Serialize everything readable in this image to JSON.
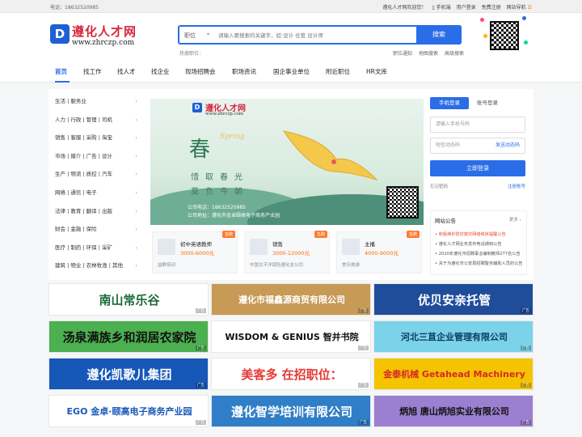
{
  "topbar": {
    "phone": "电话：18632520985",
    "welcome": "遵化人才网欢迎您！",
    "mobile": "手机端",
    "login": "用户登录",
    "register": "免费注册",
    "site_nav": "网站导航"
  },
  "logo": {
    "mark": "D",
    "cn": "遵化人才网",
    "en": "www.zhrczp.com"
  },
  "search": {
    "type_label": "职位",
    "placeholder": "请输入要搜索的关键字，如 设计 仓管 设计师",
    "button": "搜索",
    "hot_label": "热搜职位：",
    "links": [
      "职位通知",
      "地图搜索",
      "高级搜索"
    ]
  },
  "nav": {
    "items": [
      "首页",
      "找工作",
      "找人才",
      "找企业",
      "现场招聘会",
      "职场资讯",
      "国企事业单位",
      "附近职位",
      "HR文库"
    ]
  },
  "categories": [
    "生活 | 服务业",
    "人力 | 行政 | 管理 | 司机",
    "销售 | 客服 | 采购 | 淘宝",
    "市场 | 媒介 | 广告 | 设计",
    "生产 | 物流 | 质控 | 汽车",
    "网络 | 通信 | 电子",
    "法律 | 教育 | 翻译 | 出版",
    "财会 | 金融 | 保险",
    "医疗 | 制药 | 环保 | 采矿",
    "建筑 | 物业 | 农林牧渔 | 其他"
  ],
  "category_arrow": "›",
  "banner": {
    "logo_mark": "D",
    "logo_cn": "遵化人才网",
    "logo_en": "www.zhrczp.com",
    "spring": "春",
    "spring_en": "Spring",
    "poem_line1": "惜取春光",
    "poem_line2": "莫负今朝",
    "phone": "公司电话：18632520985",
    "address": "公司地址：遵化市金卓颐高电子商务产业园"
  },
  "jobs": [
    {
      "tag": "急聘",
      "logo": "",
      "title": "初中英语教师",
      "salary": "3000-6000元",
      "company": "益群培训"
    },
    {
      "tag": "急聘",
      "logo": "",
      "title": "销售",
      "salary": "3000-12000元",
      "company": "中国太平洋保险遵化支公司"
    },
    {
      "tag": "急聘",
      "logo": "",
      "title": "主播",
      "salary": "4000-9000元",
      "company": "常乐旅游"
    }
  ],
  "login": {
    "tab_mobile": "手机登录",
    "tab_account": "账号登录",
    "phone_placeholder": "请输入手机号码",
    "code_placeholder": "短信动态码",
    "send_code": "发送动态码",
    "submit": "立即登录",
    "forgot": "忘记密码",
    "register": "注册账号"
  },
  "notice": {
    "title": "网站公告",
    "more": "更多 ›",
    "items": [
      "积极维护防灾救灾网络秩序提醒公告",
      "遵化人才网业务发布电话通知公告",
      "2020年遵化市招聘事业编制教师277名公告",
      "关于为遵化市公安局招聘警务辅助人员的公告"
    ]
  },
  "ads": [
    {
      "text": "南山常乐谷",
      "bg": "#ffffff",
      "color": "#1b6b3a"
    },
    {
      "text": "遵化市福鑫源商贸有限公司",
      "bg": "#c79a55",
      "color": "#ffffff"
    },
    {
      "text": "优贝安亲托管",
      "bg": "#1f4d9a",
      "color": "#ffffff"
    },
    {
      "text": "汤泉满族乡和润居农家院",
      "bg": "#4caf50",
      "color": "#111111"
    },
    {
      "text": "WISDOM & GENIUS 智并书院",
      "bg": "#ffffff",
      "color": "#111111"
    },
    {
      "text": "河北三苴企业管理有限公司",
      "bg": "#7ad3e8",
      "color": "#0d3a66"
    },
    {
      "text": "遵化凯歌儿集团",
      "bg": "#1657b8",
      "color": "#ffffff"
    },
    {
      "text": "美客多 在招职位：",
      "bg": "#ffffff",
      "color": "#e53935"
    },
    {
      "text": "金泰机械 Getahead Machinery",
      "bg": "#f5c400",
      "color": "#d62828"
    },
    {
      "text": "EGO 金卓·颐高电子商务产业园",
      "bg": "#ffffff",
      "color": "#1657b8"
    },
    {
      "text": "遵化智学培训有限公司",
      "bg": "#2f7ec7",
      "color": "#ffffff"
    },
    {
      "text": "炳旭 唐山炳旭实业有限公司",
      "bg": "#9b7fd0",
      "color": "#111111"
    }
  ],
  "ad_tag": "广告",
  "colors": {
    "primary": "#2a6de8",
    "logo_red": "#d7263d",
    "salary": "#ff6a00",
    "urgent": "#ff7b2e"
  }
}
